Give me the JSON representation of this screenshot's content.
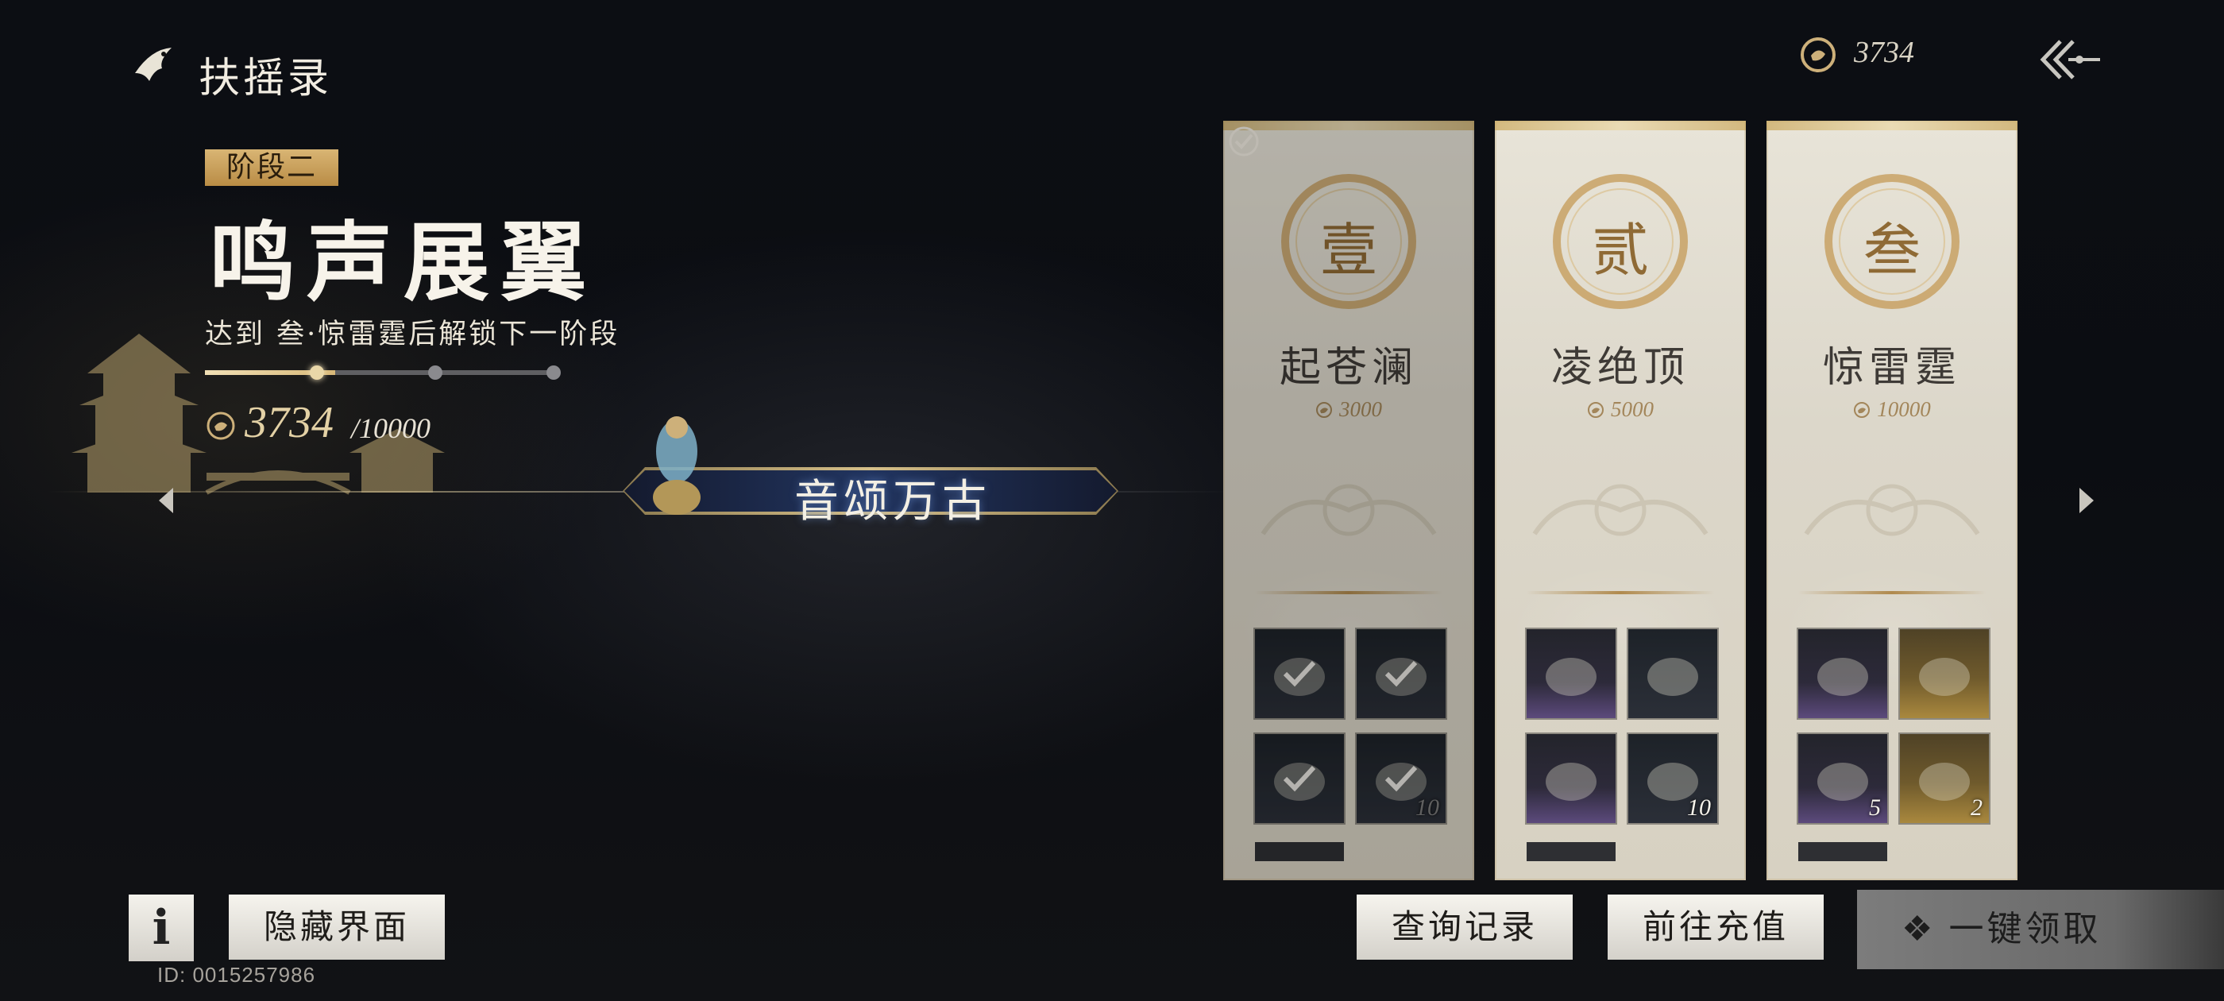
{
  "header": {
    "title": "扶摇录",
    "currency_value": "3734",
    "icons": {
      "title": "bird-icon",
      "currency": "coin-icon",
      "back": "back-arrow-icon"
    }
  },
  "stage": {
    "badge": "阶段二",
    "name": "鸣声展翼",
    "hint": "达到 叁·惊雷霆后解锁下一阶段",
    "points_current": "3734",
    "points_total": "/10000",
    "progress": 0.3734
  },
  "featured": {
    "title": "音颂万古"
  },
  "cards": [
    {
      "numeral": "壹",
      "name": "起苍澜",
      "cost": "3000",
      "claimed": true,
      "items": [
        {
          "icon": "glove-icon",
          "qty": "",
          "claimed": true,
          "tone": "dark"
        },
        {
          "icon": "cape-icon",
          "qty": "",
          "claimed": true,
          "tone": "dark"
        },
        {
          "icon": "tablet-icon",
          "qty": "",
          "claimed": true,
          "tone": "dark"
        },
        {
          "icon": "jar-icon",
          "qty": "10",
          "claimed": true,
          "tone": "dark"
        }
      ]
    },
    {
      "numeral": "贰",
      "name": "凌绝顶",
      "cost": "5000",
      "claimed": false,
      "items": [
        {
          "icon": "robe-icon",
          "qty": "",
          "claimed": false,
          "tone": "purple"
        },
        {
          "icon": "card-icon",
          "qty": "",
          "claimed": false,
          "tone": "dark"
        },
        {
          "icon": "accessory-icon",
          "qty": "",
          "claimed": false,
          "tone": "purple"
        },
        {
          "icon": "jar-icon",
          "qty": "10",
          "claimed": false,
          "tone": "dark"
        }
      ]
    },
    {
      "numeral": "叁",
      "name": "惊雷霆",
      "cost": "10000",
      "claimed": false,
      "items": [
        {
          "icon": "pet-icon",
          "qty": "",
          "claimed": false,
          "tone": "purple"
        },
        {
          "icon": "scroll-icon",
          "qty": "",
          "claimed": false,
          "tone": "gold"
        },
        {
          "icon": "gem-box-icon",
          "qty": "5",
          "claimed": false,
          "tone": "purple"
        },
        {
          "icon": "ingot-icon",
          "qty": "2",
          "claimed": false,
          "tone": "gold"
        }
      ]
    }
  ],
  "buttons": {
    "info": "i",
    "hide": "隐藏界面",
    "query": "查询记录",
    "topup": "前往充值",
    "claim_all": "一键领取",
    "claim_icon": "❖"
  },
  "user_id": "ID: 0015257986",
  "colors": {
    "accent_gold": "#d9b574",
    "card_bg": "#e8e4d8",
    "numeral": "#8f6a35"
  }
}
